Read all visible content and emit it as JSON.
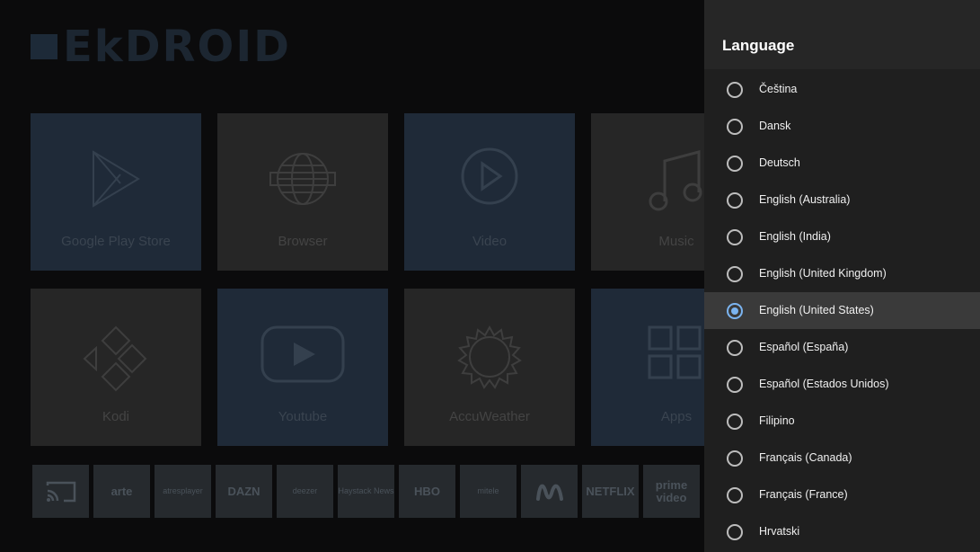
{
  "launcher": {
    "brand": "EkDROID",
    "tiles": [
      {
        "label": "Google Play Store",
        "icon": "play-store-icon"
      },
      {
        "label": "Browser",
        "icon": "globe-icon"
      },
      {
        "label": "Video",
        "icon": "play-circle-icon"
      },
      {
        "label": "Music",
        "icon": "music-note-icon"
      },
      {
        "label": "Kodi",
        "icon": "kodi-icon"
      },
      {
        "label": "Youtube",
        "icon": "youtube-icon"
      },
      {
        "label": "AccuWeather",
        "icon": "sun-icon"
      },
      {
        "label": "Apps",
        "icon": "apps-grid-icon"
      }
    ],
    "apps": [
      {
        "label": "",
        "icon": "cast-icon"
      },
      {
        "label": "arte"
      },
      {
        "label": "atresplayer"
      },
      {
        "label": "DAZN"
      },
      {
        "label": "deezer"
      },
      {
        "label": "Haystack News"
      },
      {
        "label": "HBO"
      },
      {
        "label": "mitele"
      },
      {
        "label": "",
        "icon": "movistar-icon"
      },
      {
        "label": "NETFLIX"
      },
      {
        "label": "prime video"
      }
    ]
  },
  "panel": {
    "title": "Language",
    "options": [
      {
        "label": "Čeština",
        "selected": false
      },
      {
        "label": "Dansk",
        "selected": false
      },
      {
        "label": "Deutsch",
        "selected": false
      },
      {
        "label": "English (Australia)",
        "selected": false
      },
      {
        "label": "English (India)",
        "selected": false
      },
      {
        "label": "English (United Kingdom)",
        "selected": false
      },
      {
        "label": "English (United States)",
        "selected": true
      },
      {
        "label": "Español (España)",
        "selected": false
      },
      {
        "label": "Español (Estados Unidos)",
        "selected": false
      },
      {
        "label": "Filipino",
        "selected": false
      },
      {
        "label": "Français (Canada)",
        "selected": false
      },
      {
        "label": "Français (France)",
        "selected": false
      },
      {
        "label": "Hrvatski",
        "selected": false
      }
    ],
    "accent": "#7bb4f0"
  }
}
